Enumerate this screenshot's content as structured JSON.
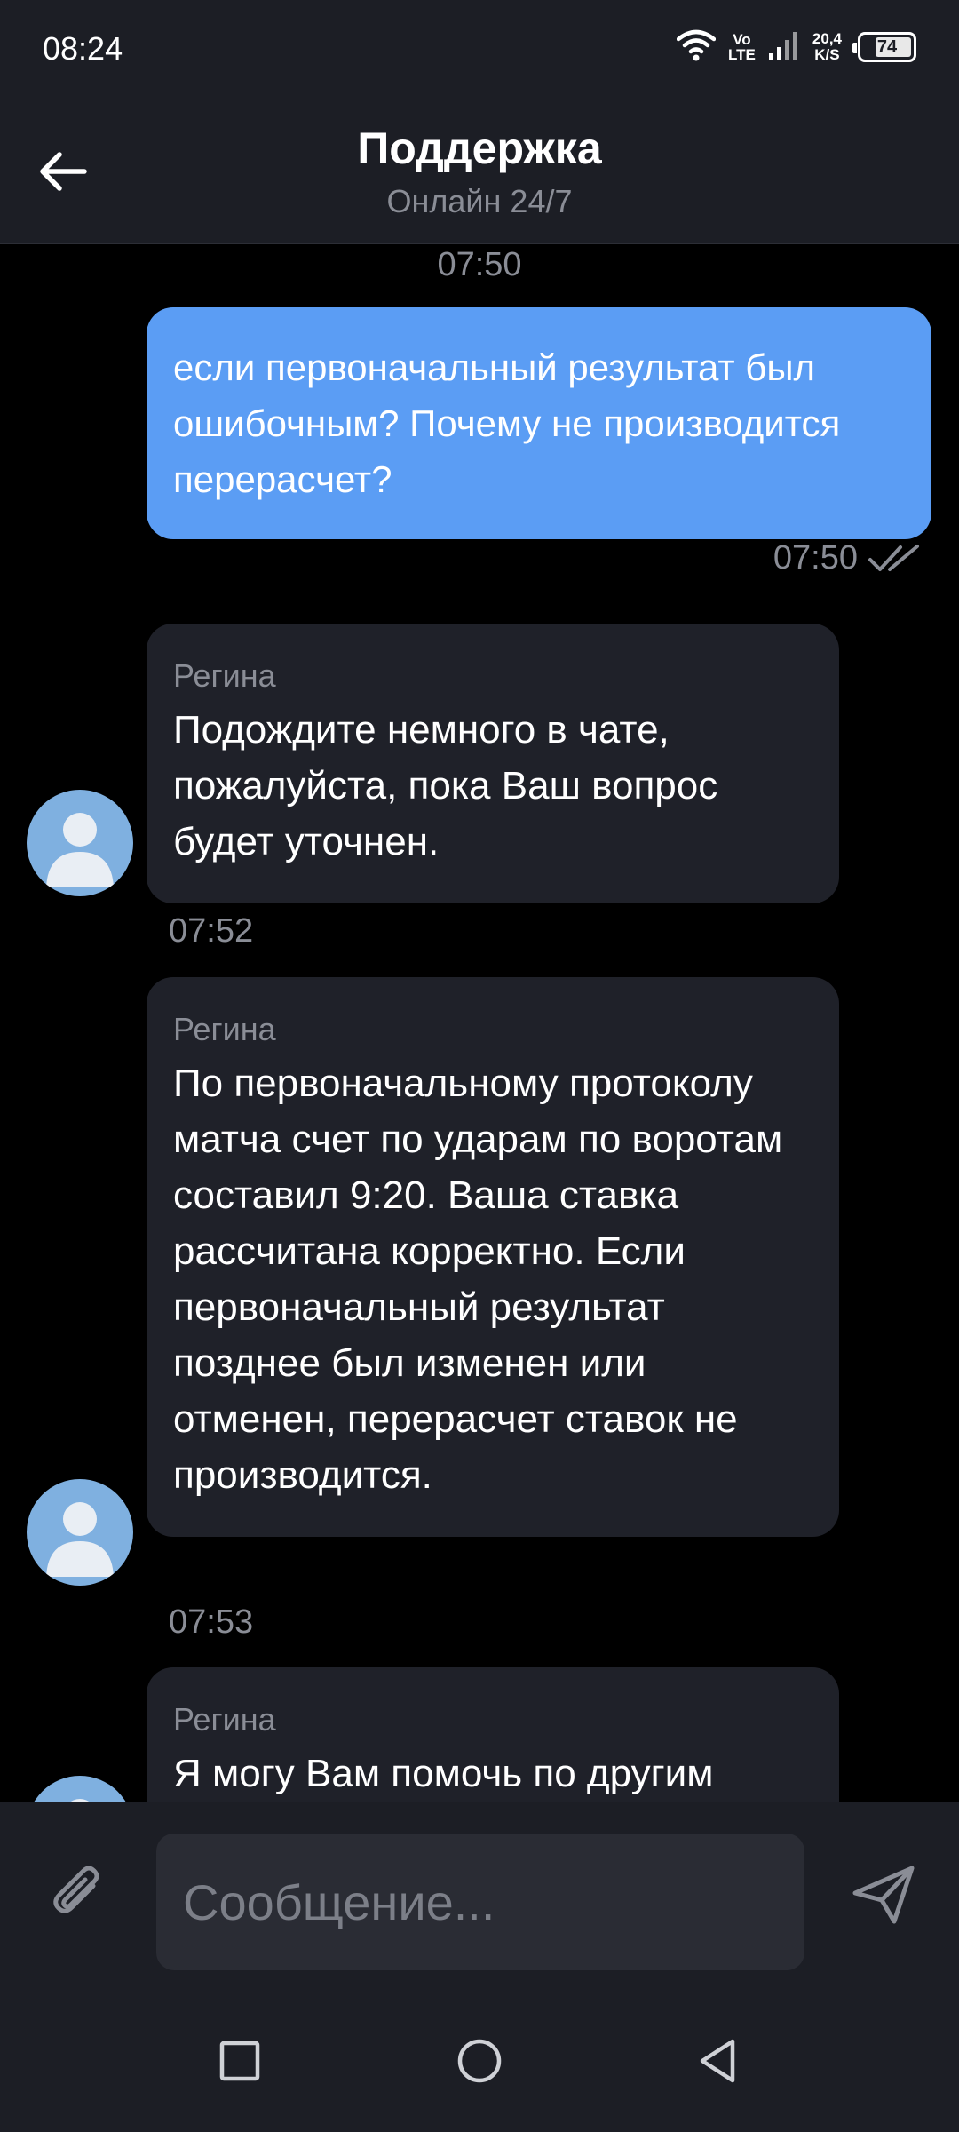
{
  "status_bar": {
    "time": "08:24",
    "volte_top": "Vo",
    "volte_bottom": "LTE",
    "speed_value": "20,4",
    "speed_unit": "K/S",
    "battery": "74",
    "battery_level": 0.74,
    "icons": [
      "wifi-icon",
      "volte-indicator",
      "signal-icon",
      "network-speed",
      "battery-icon"
    ]
  },
  "header": {
    "title": "Поддержка",
    "subtitle": "Онлайн 24/7",
    "back_icon": "arrow-left-icon"
  },
  "messages": [
    {
      "direction": "outgoing",
      "time_above": "07:50",
      "text": "если первоначальный результат был ошибочным? Почему не производится перерасчет?",
      "time": "07:50",
      "status_icon": "double-check-icon"
    },
    {
      "direction": "incoming",
      "sender": "Регина",
      "text": "Подождите немного в чате, пожалуйста, пока Ваш вопрос будет уточнен.",
      "time": "07:52"
    },
    {
      "direction": "incoming",
      "sender": "Регина",
      "text": "По первоначальному протоколу матча счет по ударам по воротам составил 9:20. Ваша ставка рассчитана корректно. Если первоначальный результат позднее был изменен или отменен, перерасчет ставок не производится.",
      "time": "07:53"
    },
    {
      "direction": "incoming",
      "sender": "Регина",
      "text": "Я могу Вам помочь по другим"
    }
  ],
  "input": {
    "placeholder": "Сообщение...",
    "attach_icon": "paperclip-icon",
    "send_icon": "send-icon"
  },
  "nav_bar": {
    "buttons": [
      "recents-square-icon",
      "home-circle-icon",
      "back-triangle-icon"
    ]
  },
  "colors": {
    "background": "#000000",
    "bar": "#1c1e25",
    "outgoing_bubble": "#5b9df4",
    "incoming_bubble": "#1f2129",
    "muted_text": "#8a8d96"
  }
}
